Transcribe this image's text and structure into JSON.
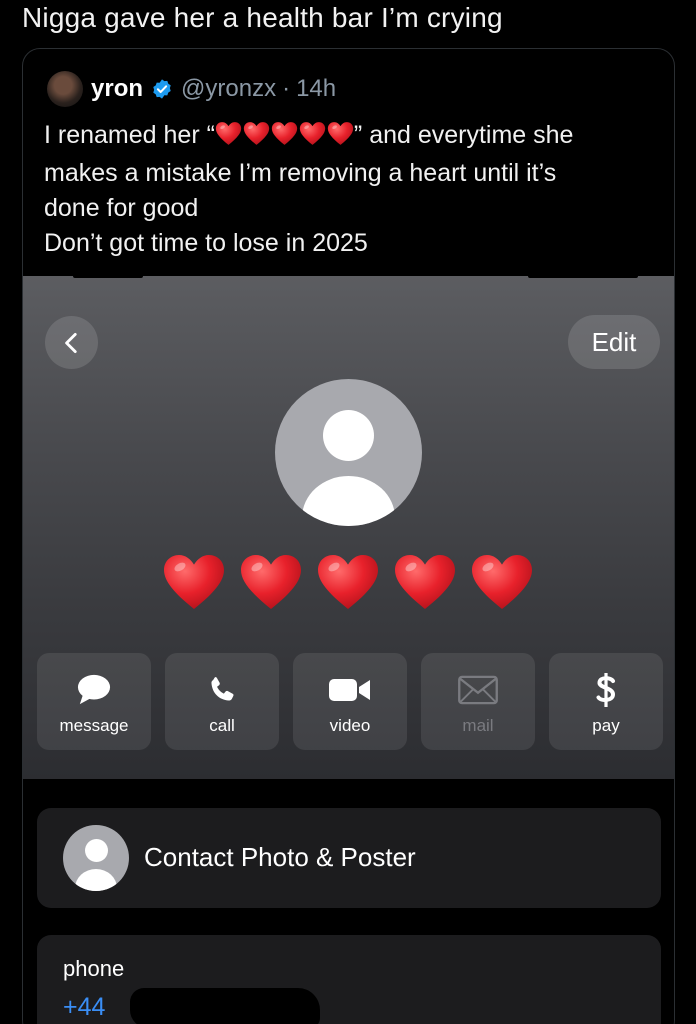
{
  "caption": "Nigga gave her a health bar I’m crying",
  "tweet": {
    "author_name": "yron",
    "handle": "@yronzx",
    "separator": "·",
    "time": "14h",
    "line1_prefix": "I renamed her “",
    "line1_suffix": "” and everytime she",
    "line2": "makes a mistake I’m removing a heart until it’s",
    "line3": "done for good",
    "line4": "Don’t got time to lose in 2025",
    "inline_hearts_count": 5
  },
  "contact": {
    "edit_label": "Edit",
    "name_hearts_count": 5,
    "actions": [
      {
        "label": "message",
        "icon": "message-bubble-icon",
        "enabled": true
      },
      {
        "label": "call",
        "icon": "phone-icon",
        "enabled": true
      },
      {
        "label": "video",
        "icon": "video-camera-icon",
        "enabled": true
      },
      {
        "label": "mail",
        "icon": "envelope-icon",
        "enabled": false
      },
      {
        "label": "pay",
        "icon": "dollar-icon",
        "enabled": true
      }
    ],
    "photo_poster_label": "Contact Photo & Poster",
    "phone_label": "phone",
    "phone_number_visible": "+44"
  },
  "colors": {
    "heart": "#e8212b",
    "link_blue": "#3a8ef5",
    "verified": "#1d9bf0",
    "muted": "#8b98a5"
  }
}
